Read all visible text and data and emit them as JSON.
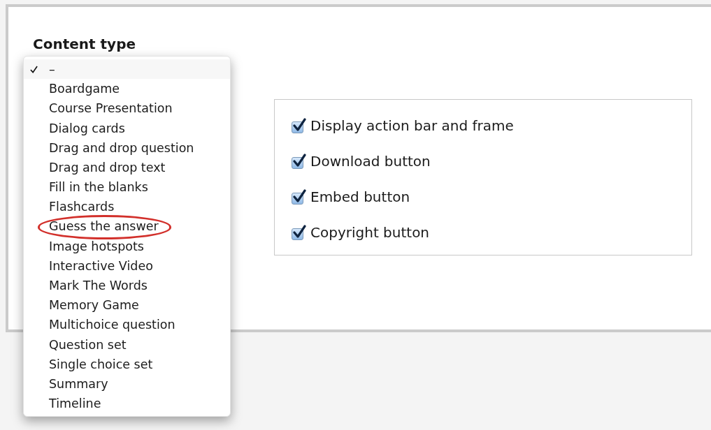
{
  "content_type": {
    "label": "Content type",
    "options": [
      {
        "label": "–",
        "selected": true,
        "circled": false
      },
      {
        "label": "Boardgame",
        "selected": false,
        "circled": false
      },
      {
        "label": "Course Presentation",
        "selected": false,
        "circled": false
      },
      {
        "label": "Dialog cards",
        "selected": false,
        "circled": false
      },
      {
        "label": "Drag and drop question",
        "selected": false,
        "circled": false
      },
      {
        "label": "Drag and drop text",
        "selected": false,
        "circled": false
      },
      {
        "label": "Fill in the blanks",
        "selected": false,
        "circled": false
      },
      {
        "label": "Flashcards",
        "selected": false,
        "circled": false
      },
      {
        "label": "Guess the answer",
        "selected": false,
        "circled": true
      },
      {
        "label": "Image hotspots",
        "selected": false,
        "circled": false
      },
      {
        "label": "Interactive Video",
        "selected": false,
        "circled": false
      },
      {
        "label": "Mark The Words",
        "selected": false,
        "circled": false
      },
      {
        "label": "Memory Game",
        "selected": false,
        "circled": false
      },
      {
        "label": "Multichoice question",
        "selected": false,
        "circled": false
      },
      {
        "label": "Question set",
        "selected": false,
        "circled": false
      },
      {
        "label": "Single choice set",
        "selected": false,
        "circled": false
      },
      {
        "label": "Summary",
        "selected": false,
        "circled": false
      },
      {
        "label": "Timeline",
        "selected": false,
        "circled": false
      }
    ]
  },
  "display_options": [
    {
      "label": "Display action bar and frame",
      "checked": true
    },
    {
      "label": "Download button",
      "checked": true
    },
    {
      "label": "Embed button",
      "checked": true
    },
    {
      "label": "Copyright button",
      "checked": true
    }
  ]
}
